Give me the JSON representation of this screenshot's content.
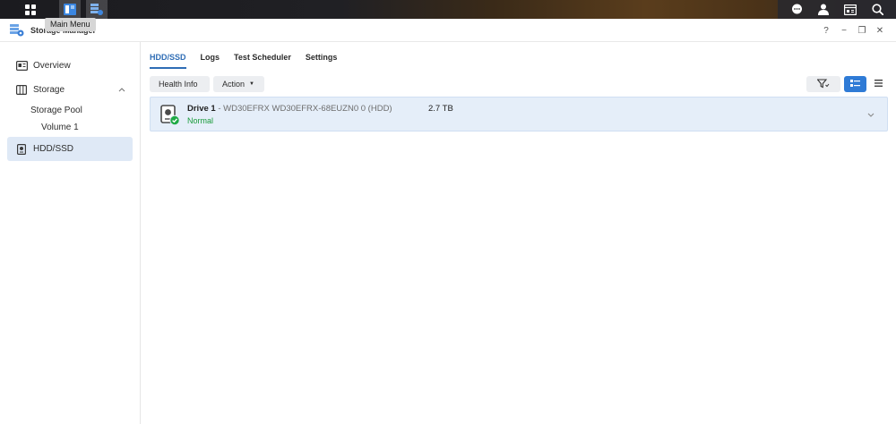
{
  "taskbar": {
    "tooltip": "Main Menu",
    "left_icons": [
      "apps-grid-icon",
      "main-menu-icon",
      "storage-manager-icon"
    ],
    "right_icons": [
      "chat-icon",
      "user-icon",
      "widgets-icon",
      "search-icon"
    ]
  },
  "window": {
    "title": "Storage Manager",
    "controls": {
      "help": "?",
      "minimize": "−",
      "restore": "❐",
      "close": "✕"
    }
  },
  "sidebar": {
    "items": [
      {
        "label": "Overview",
        "icon": "overview-icon"
      },
      {
        "label": "Storage",
        "icon": "storage-icon"
      },
      {
        "label": "Storage Pool"
      },
      {
        "label": "Volume 1"
      },
      {
        "label": "HDD/SSD",
        "icon": "hdd-icon"
      }
    ]
  },
  "tabs": [
    "HDD/SSD",
    "Logs",
    "Test Scheduler",
    "Settings"
  ],
  "toolbar": {
    "health_info": "Health Info",
    "action": "Action"
  },
  "drives": [
    {
      "name": "Drive 1",
      "separator": " - ",
      "model": "WD30EFRX WD30EFRX-68EUZN0 0 (HDD)",
      "status": "Normal",
      "size": "2.7 TB"
    }
  ],
  "colors": {
    "accent": "#2f6db5",
    "status_ok": "#1a9b3a",
    "selected_row": "#e5eef9"
  }
}
